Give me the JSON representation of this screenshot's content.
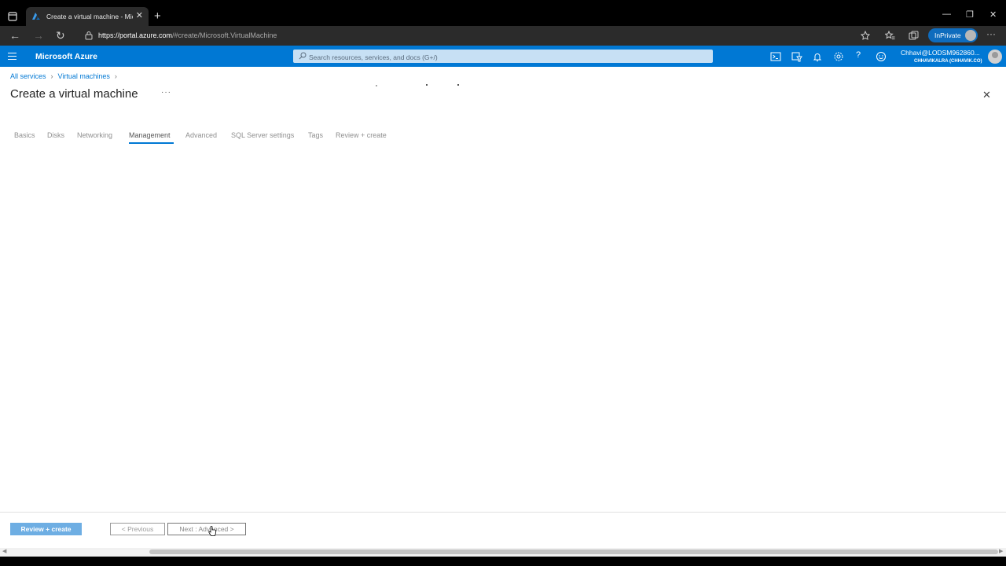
{
  "browser": {
    "tab_title": "Create a virtual machine - Microsoft Azure",
    "new_tab": "+",
    "window_controls": {
      "minimize": "—",
      "restore": "❐",
      "close": "✕"
    },
    "url_host": "https://portal.azure.com",
    "url_path": "/#create/Microsoft.VirtualMachine",
    "inprivate_label": "InPrivate"
  },
  "azure": {
    "brand": "Microsoft Azure",
    "search_placeholder": "Search resources, services, and docs (G+/)",
    "user_name": "Chhavi@LODSM962860...",
    "user_tenant": "CHHAVIKALRA (CHHAVIK.CO)"
  },
  "breadcrumb": {
    "items": [
      "All services",
      "Virtual machines"
    ]
  },
  "page": {
    "title": "Create a virtual machine",
    "more": "···",
    "close": "✕"
  },
  "tabs": [
    {
      "label": "Basics",
      "active": false
    },
    {
      "label": "Disks",
      "active": false
    },
    {
      "label": "Networking",
      "active": false
    },
    {
      "label": "Management",
      "active": true
    },
    {
      "label": "Advanced",
      "active": false
    },
    {
      "label": "SQL Server settings",
      "active": false
    },
    {
      "label": "Tags",
      "active": false
    },
    {
      "label": "Review + create",
      "active": false
    }
  ],
  "footer": {
    "review_create": "Review + create",
    "previous": "< Previous",
    "next": "Next : Advanced >"
  },
  "colors": {
    "azure_blue": "#0078d4",
    "primary_disabled": "#6eaee3"
  }
}
